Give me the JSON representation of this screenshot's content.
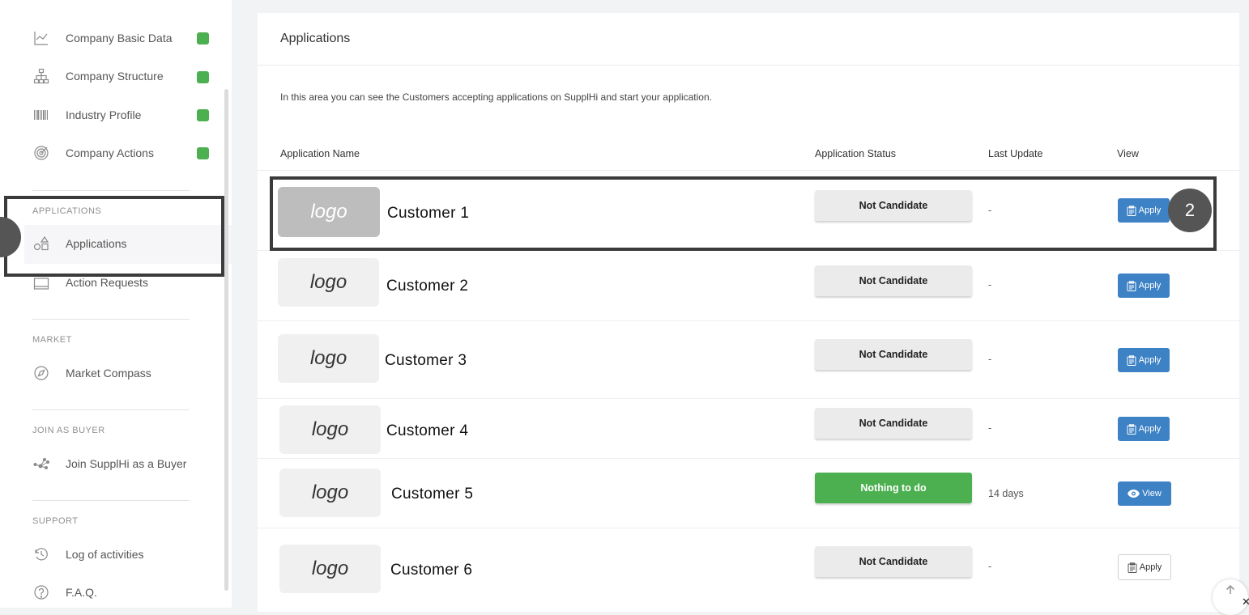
{
  "sidebar": {
    "items_top": [
      {
        "label": "Company Basic Data",
        "icon": "chart-icon"
      },
      {
        "label": "Company Structure",
        "icon": "org-chart-icon"
      },
      {
        "label": "Industry Profile",
        "icon": "barcode-icon"
      },
      {
        "label": "Company Actions",
        "icon": "target-icon"
      }
    ],
    "sections": {
      "applications": "APPLICATIONS",
      "market": "MARKET",
      "join": "JOIN AS BUYER",
      "support": "SUPPORT"
    },
    "applications_label": "Applications",
    "action_requests_label": "Action Requests",
    "market_compass_label": "Market Compass",
    "join_label": "Join SupplHi as a Buyer",
    "log_label": "Log of activities",
    "faq_label": "F.A.Q."
  },
  "main": {
    "title": "Applications",
    "description": "In this area you can see the Customers accepting applications on SupplHi and start your application.",
    "columns": [
      "Application Name",
      "Application Status",
      "Last Update",
      "View"
    ],
    "rows": [
      {
        "logo": "logo",
        "name": "Customer 1",
        "status": "Not Candidate",
        "last_update": "-",
        "action": "Apply"
      },
      {
        "logo": "logo",
        "name": "Customer 2",
        "status": "Not Candidate",
        "last_update": "-",
        "action": "Apply"
      },
      {
        "logo": "logo",
        "name": "Customer 3",
        "status": "Not Candidate",
        "last_update": "-",
        "action": "Apply"
      },
      {
        "logo": "logo",
        "name": "Customer 4",
        "status": "Not Candidate",
        "last_update": "-",
        "action": "Apply"
      },
      {
        "logo": "logo",
        "name": "Customer 5",
        "status": "Nothing to do",
        "last_update": "14 days",
        "action": "View"
      },
      {
        "logo": "logo",
        "name": "Customer 6",
        "status": "Not Candidate",
        "last_update": "-",
        "action": "Apply"
      }
    ]
  },
  "annotations": {
    "marker2": "2"
  },
  "colors": {
    "accent_blue": "#3d82c4",
    "status_green": "#4caf50",
    "complete_dot": "#4caf50"
  }
}
